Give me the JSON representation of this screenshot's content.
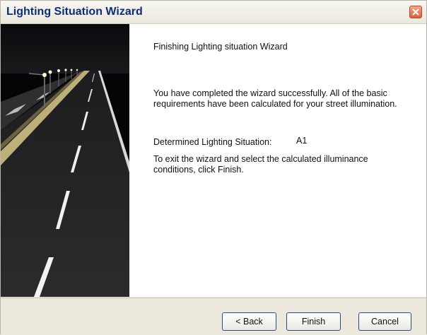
{
  "window": {
    "title": "Lighting Situation Wizard"
  },
  "content": {
    "heading": "Finishing Lighting situation Wizard",
    "completion_text": "You have completed the wizard successfully. All of the basic requirements have been calculated for your street illumination.",
    "situation_label": "Determined Lighting Situation:",
    "situation_value": "A1",
    "exit_text": "To exit the wizard and select the calculated illuminance conditions, click Finish."
  },
  "buttons": {
    "back": "< Back",
    "finish": "Finish",
    "cancel": "Cancel"
  },
  "icons": {
    "close": "close-icon",
    "banner": "street-road-night-image"
  },
  "colors": {
    "title_text": "#0d2d74",
    "close_button": "#d8603f",
    "button_border": "#2a4a8c",
    "highway_edge": "#d9c98a"
  }
}
